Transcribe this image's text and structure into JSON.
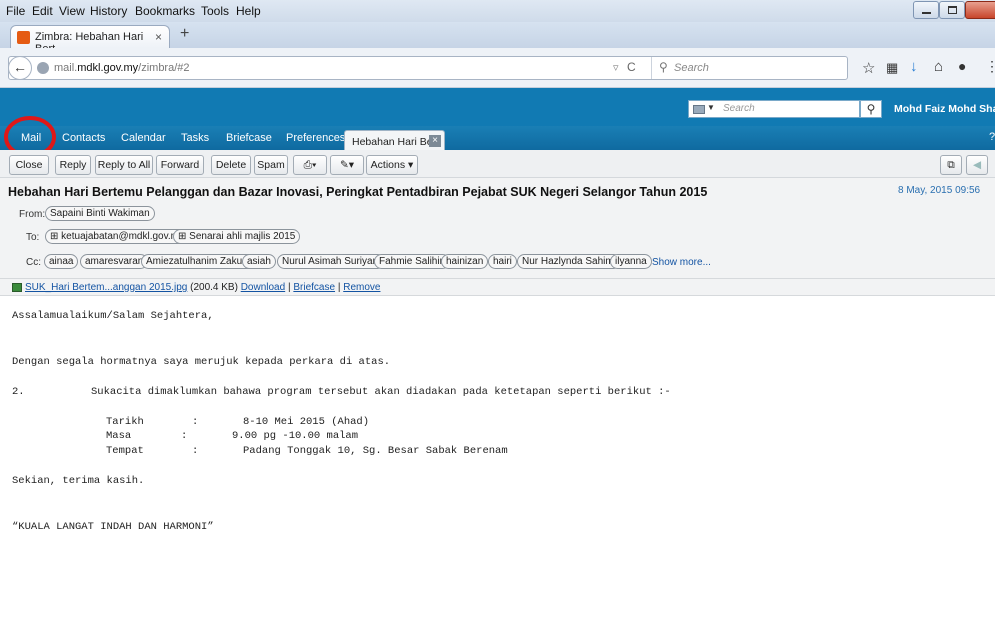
{
  "menubar": {
    "file": "File",
    "edit": "Edit",
    "view": "View",
    "history": "History",
    "bookmarks": "Bookmarks",
    "tools": "Tools",
    "help": "Help"
  },
  "browser": {
    "tab_title": "Zimbra: Hebahan Hari Bert...",
    "tab_close": "×",
    "new_tab": "+",
    "url_prefix": "mail.",
    "url_domain": "mdkl.gov.my",
    "url_path": "/zimbra/#2",
    "search_placeholder": "Search"
  },
  "zimbra": {
    "search_placeholder": "Search",
    "user_name": "Mohd Faiz Mohd Shauji",
    "tabs": {
      "mail": "Mail",
      "contacts": "Contacts",
      "calendar": "Calendar",
      "tasks": "Tasks",
      "briefcase": "Briefcase",
      "preferences": "Preferences"
    },
    "open_tab": "Hebahan Hari Be",
    "accent_color": "#117ab3",
    "annotation_color": "#e01818"
  },
  "toolbar": {
    "close": "Close",
    "reply": "Reply",
    "reply_all": "Reply to All",
    "forward": "Forward",
    "delete": "Delete",
    "spam": "Spam",
    "actions": "Actions"
  },
  "message": {
    "subject": "Hebahan Hari Bertemu Pelanggan dan Bazar Inovasi, Peringkat Pentadbiran Pejabat SUK Negeri Selangor Tahun 2015",
    "date": "8 May, 2015 09:56",
    "from_label": "From:",
    "from": "Sapaini Binti Wakiman",
    "to_label": "To:",
    "to": [
      "ketuajabatan@mdkl.gov.my",
      "Senarai ahli majlis 2015"
    ],
    "cc_label": "Cc:",
    "cc": [
      "ainaa",
      "amaresvaran",
      "Amiezatulhanim Zakuan",
      "asiah",
      "Nurul Asimah Suriyani",
      "Fahmie Salihin",
      "hainizan",
      "hairi",
      "Nur Hazlynda Sahimi",
      "ilyanna"
    ],
    "show_more": "Show more...",
    "attachment": {
      "name": "SUK_Hari Bertem...anggan 2015.jpg",
      "size": "(200.4 KB)",
      "download": "Download",
      "briefcase": "Briefcase",
      "remove": "Remove",
      "sep1": "|",
      "sep2": "|"
    }
  },
  "body_lines": {
    "l1": "Assalamualaikum/Salam Sejahtera,",
    "l2": "Dengan segala hormatnya saya merujuk kepada perkara di atas.",
    "l3_num": "2.",
    "l3_text": "Sukacita dimaklumkan bahawa program tersebut akan diadakan pada ketetapan seperti berikut :-",
    "tarikh_k": "Tarikh",
    "tarikh_c": ":",
    "tarikh_v": "8-10 Mei 2015 (Ahad)",
    "masa_k": "Masa",
    "masa_c": ":",
    "masa_v": "9.00 pg -10.00 malam",
    "tempat_k": "Tempat",
    "tempat_c": ":",
    "tempat_v": "Padang Tonggak 10, Sg. Besar Sabak Berenam",
    "l4": "Sekian, terima kasih.",
    "l5": "“KUALA LANGAT INDAH DAN HARMONI”"
  }
}
